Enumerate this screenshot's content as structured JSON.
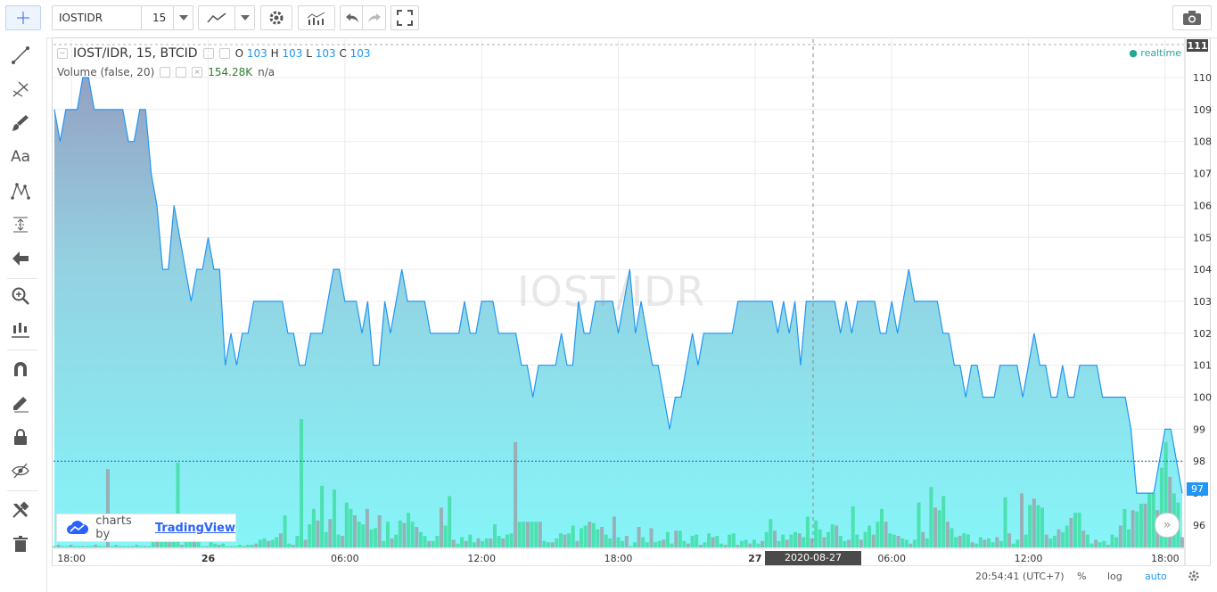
{
  "toolbar": {
    "symbol": "IOSTIDR",
    "interval": "15"
  },
  "legend": {
    "title": "IOST/IDR, 15, BTCID",
    "o_label": "O",
    "o": "103",
    "h_label": "H",
    "h": "103",
    "l_label": "L",
    "l": "103",
    "c_label": "C",
    "c": "103",
    "volume_title": "Volume (false, 20)",
    "volume_value": "154.28K",
    "volume_na": "n/a",
    "realtime": "realtime"
  },
  "watermark": "IOST/IDR",
  "branding": {
    "prefix": "charts by",
    "name": "TradingView"
  },
  "crosshair_time": "2020-08-27 03:45:00",
  "bottom": {
    "clock": "20:54:41 (UTC+7)",
    "percent": "%",
    "log": "log",
    "auto": "auto"
  },
  "chart_data": {
    "type": "area",
    "y_ticks": [
      96,
      97,
      98,
      99,
      100,
      101,
      102,
      103,
      104,
      105,
      106,
      107,
      108,
      109,
      110
    ],
    "y_top_label": "111",
    "last_price_label": "97",
    "ylim": [
      95.3,
      111.2
    ],
    "x_tick_labels": [
      {
        "t": 3,
        "label": "18:00"
      },
      {
        "t": 27,
        "label": "26"
      },
      {
        "t": 51,
        "label": "06:00"
      },
      {
        "t": 75,
        "label": "12:00"
      },
      {
        "t": 99,
        "label": "18:00"
      },
      {
        "t": 123,
        "label": "27"
      },
      {
        "t": 147,
        "label": "06:00"
      },
      {
        "t": 171,
        "label": "12:00"
      },
      {
        "t": 195,
        "label": "18:00"
      }
    ],
    "price": [
      109,
      108,
      109,
      109,
      109,
      110,
      110,
      109,
      109,
      109,
      109,
      109,
      109,
      108,
      108,
      109,
      109,
      107,
      106,
      104,
      104,
      106,
      105,
      104,
      103,
      104,
      104,
      105,
      104,
      104,
      101,
      102,
      101,
      102,
      102,
      103,
      103,
      103,
      103,
      103,
      103,
      102,
      102,
      101,
      101,
      102,
      102,
      102,
      103,
      104,
      104,
      103,
      103,
      103,
      102,
      103,
      101,
      101,
      103,
      102,
      103,
      104,
      103,
      103,
      103,
      103,
      102,
      102,
      102,
      102,
      102,
      102,
      103,
      102,
      102,
      103,
      103,
      103,
      102,
      102,
      102,
      102,
      101,
      101,
      100,
      101,
      101,
      101,
      101,
      102,
      101,
      101,
      103,
      102,
      102,
      103,
      103,
      103,
      103,
      102,
      103,
      104,
      102,
      103,
      102,
      101,
      101,
      100,
      99,
      100,
      100,
      101,
      102,
      101,
      102,
      102,
      102,
      102,
      102,
      102,
      103,
      103,
      103,
      103,
      103,
      103,
      103,
      102,
      103,
      102,
      103,
      101,
      103,
      103,
      103,
      103,
      103,
      103,
      102,
      103,
      102,
      103,
      103,
      103,
      103,
      102,
      102,
      103,
      102,
      103,
      104,
      103,
      103,
      103,
      103,
      103,
      102,
      102,
      101,
      101,
      100,
      101,
      101,
      100,
      100,
      100,
      101,
      101,
      101,
      101,
      100,
      101,
      102,
      101,
      101,
      100,
      100,
      101,
      100,
      100,
      101,
      101,
      101,
      101,
      100,
      100,
      100,
      100,
      100,
      99,
      97,
      97,
      97,
      97,
      98,
      99,
      99,
      98,
      97
    ],
    "volume": [
      0.01,
      0.02,
      0.01,
      0.01,
      0.02,
      0.01,
      0.01,
      0.01,
      0.01,
      0.01,
      0.02,
      0.01,
      0.01,
      0.61,
      0.01,
      0.02,
      0.01,
      0.01,
      0.01,
      0.01,
      0.02,
      0.01,
      0.01,
      0.01,
      0.1,
      0.15,
      0.06,
      0.06,
      0.04,
      0.05,
      0.66,
      0.02,
      0.04,
      0.05,
      0.05,
      0.04,
      0.01,
      0.01,
      0.04,
      0.03,
      0.02,
      0.03,
      0.01,
      0.01,
      0.01,
      0.02,
      0.01,
      0.02,
      0.02,
      0.03,
      0.06,
      0.07,
      0.05,
      0.06,
      0.08,
      0.11,
      0.25,
      0.03,
      0.02,
      0.09,
      1.0,
      0.06,
      0.18,
      0.3,
      0.21,
      0.48,
      0.12,
      0.22,
      0.45,
      0.1,
      0.09,
      0.35,
      0.3,
      0.25,
      0.2,
      0.18,
      0.3,
      0.14,
      0.15,
      0.25,
      0.05,
      0.2,
      0.07,
      0.1,
      0.21,
      0.19,
      0.27,
      0.2,
      0.16,
      0.12,
      0.09,
      0.05,
      0.05,
      0.09,
      0.31,
      0.17,
      0.4,
      0.06,
      0.03,
      0.08,
      0.05,
      0.1,
      0.04,
      0.07,
      0.05,
      0.07,
      0.07,
      0.18,
      0.09,
      0.07,
      0.1,
      0.11,
      0.82,
      0.2,
      0.2,
      0.2,
      0.2,
      0.2,
      0.2,
      0.05,
      0.04,
      0.04,
      0.07,
      0.11,
      0.1,
      0.11,
      0.17,
      0.05,
      0.15,
      0.17,
      0.2,
      0.19,
      0.14,
      0.16,
      0.1,
      0.07,
      0.24,
      0.08,
      0.05,
      0.09,
      0.01,
      0.04,
      0.16,
      0.08,
      0.04,
      0.15,
      0.04,
      0.05,
      0.06,
      0.12,
      0.03,
      0.13,
      0.13,
      0.05,
      0.03,
      0.09,
      0.1,
      0.02,
      0.04,
      0.11,
      0.08,
      0.09,
      0.03,
      0.02,
      0.1,
      0.11,
      0.02,
      0.05,
      0.06,
      0.03,
      0.06,
      0.03,
      0.05,
      0.12,
      0.22,
      0.13,
      0.05,
      0.1,
      0.06,
      0.1,
      0.12,
      0.11,
      0.08,
      0.24,
      0.07,
      0.21,
      0.14,
      0.08,
      0.12,
      0.18,
      0.17,
      0.09,
      0.05,
      0.06,
      0.32,
      0.1,
      0.06,
      0.12,
      0.17,
      0.1,
      0.2,
      0.3,
      0.2,
      0.11,
      0.1,
      0.09,
      0.07,
      0.06,
      0.03,
      0.06,
      0.35,
      0.12,
      0.07,
      0.47,
      0.31,
      0.29,
      0.4,
      0.2,
      0.15,
      0.08,
      0.09,
      0.11,
      0.1,
      0.04,
      0.03,
      0.08,
      0.06,
      0.07,
      0.04,
      0.08,
      0.05,
      0.39,
      0.11,
      0.03,
      0.06,
      0.42,
      0.1,
      0.33,
      0.38,
      0.33,
      0.31,
      0.1,
      0.07,
      0.09,
      0.14,
      0.12,
      0.17,
      0.23,
      0.27,
      0.27,
      0.13,
      0.1,
      0.03,
      0.06,
      0.04,
      0.05,
      0.02,
      0.1,
      0.08,
      0.17,
      0.3,
      0.14,
      0.29,
      0.28,
      0.34,
      0.34,
      0.42,
      0.42,
      0.29,
      0.62,
      0.82,
      0.55,
      0.42,
      0.35,
      0.08
    ]
  }
}
